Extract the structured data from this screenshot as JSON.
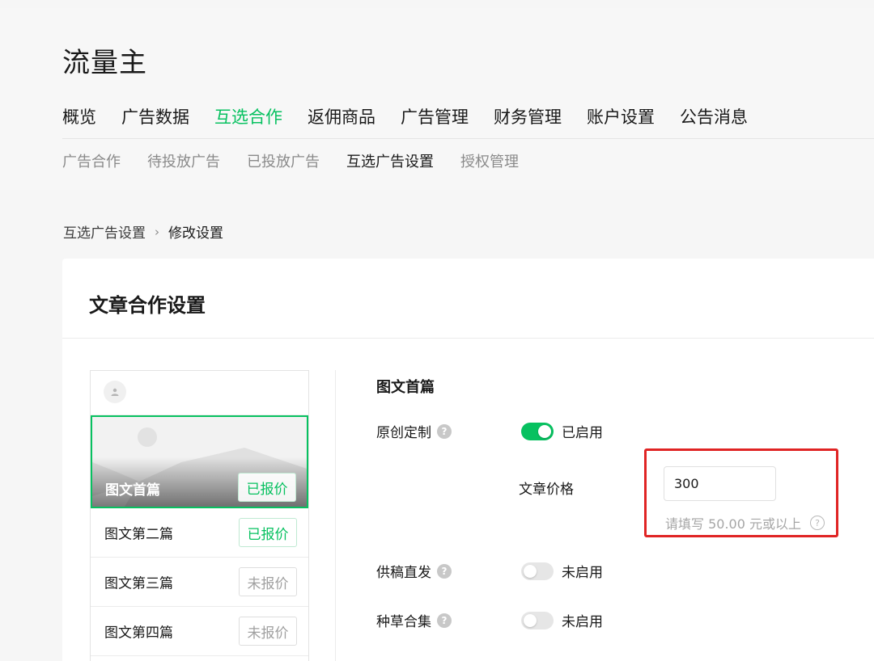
{
  "app": {
    "title": "流量主"
  },
  "main_nav": [
    {
      "label": "概览",
      "active": false
    },
    {
      "label": "广告数据",
      "active": false
    },
    {
      "label": "互选合作",
      "active": true
    },
    {
      "label": "返佣商品",
      "active": false
    },
    {
      "label": "广告管理",
      "active": false
    },
    {
      "label": "财务管理",
      "active": false
    },
    {
      "label": "账户设置",
      "active": false
    },
    {
      "label": "公告消息",
      "active": false
    }
  ],
  "sub_nav": [
    {
      "label": "广告合作",
      "active": false
    },
    {
      "label": "待投放广告",
      "active": false
    },
    {
      "label": "已投放广告",
      "active": false
    },
    {
      "label": "互选广告设置",
      "active": true
    },
    {
      "label": "授权管理",
      "active": false
    }
  ],
  "breadcrumb": {
    "parent": "互选广告设置",
    "separator": "›",
    "current": "修改设置"
  },
  "card": {
    "title": "文章合作设置"
  },
  "preview": {
    "cover": {
      "label": "图文首篇",
      "badge": "已报价",
      "quoted": true
    },
    "rows": [
      {
        "label": "图文第二篇",
        "badge": "已报价",
        "quoted": true
      },
      {
        "label": "图文第三篇",
        "badge": "未报价",
        "quoted": false
      },
      {
        "label": "图文第四篇",
        "badge": "未报价",
        "quoted": false
      }
    ]
  },
  "settings": {
    "section_title": "图文首篇",
    "original": {
      "label": "原创定制",
      "status": "已启用",
      "enabled": true
    },
    "price": {
      "label": "文章价格",
      "value": "300",
      "hint": "请填写 50.00 元或以上"
    },
    "direct": {
      "label": "供稿直发",
      "status": "未启用",
      "enabled": false
    },
    "collection": {
      "label": "种草合集",
      "status": "未启用",
      "enabled": false
    }
  },
  "icons": {
    "help": "help-icon",
    "avatar": "avatar-icon",
    "chevron": "chevron-right-icon"
  },
  "colors": {
    "accent": "#07c160",
    "highlight": "#e02424",
    "muted": "#a6a6a6"
  }
}
